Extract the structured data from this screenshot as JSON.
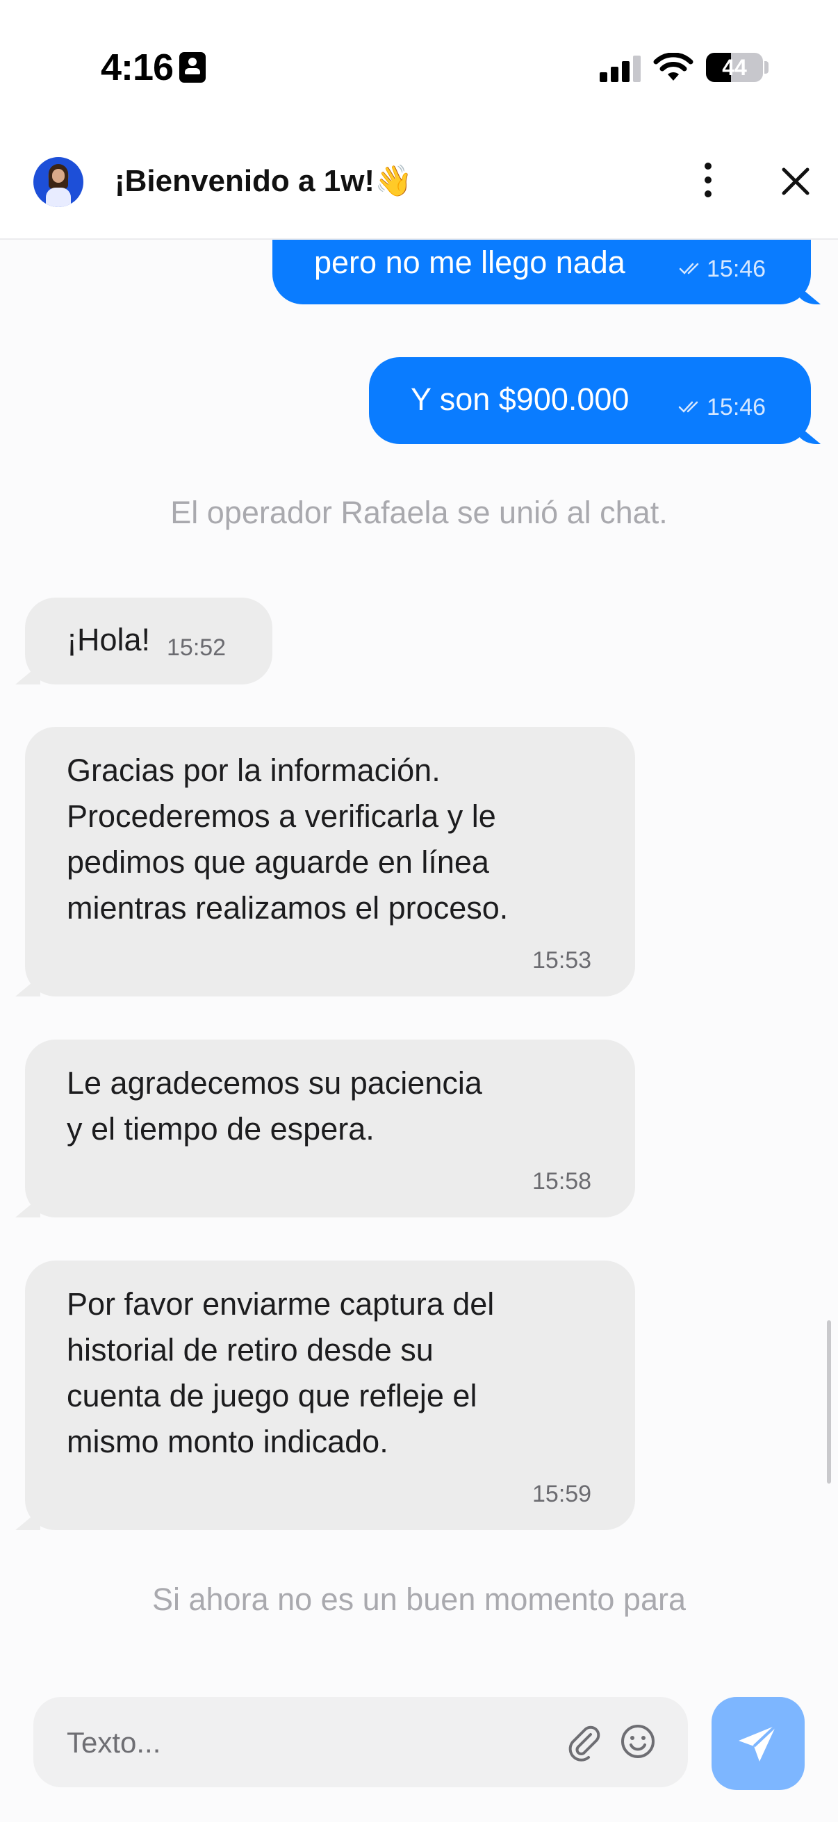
{
  "status_bar": {
    "time": "4:16",
    "battery": "44",
    "battery_level": 0.44
  },
  "header": {
    "title": "¡Bienvenido a 1w!👋",
    "avatar_icon": "agent-avatar",
    "menu_icon": "more-vertical-icon",
    "close_icon": "close-icon"
  },
  "messages": [
    {
      "direction": "outgoing",
      "text": "pero no me llego nada",
      "time": "15:46",
      "read": true
    },
    {
      "direction": "outgoing",
      "text": "Y son $900.000",
      "time": "15:46",
      "read": true
    },
    {
      "direction": "system",
      "text": "El operador Rafaela se unió al chat."
    },
    {
      "direction": "incoming",
      "text": "¡Hola!",
      "time": "15:52"
    },
    {
      "direction": "incoming",
      "text": "Gracias por la información. Procederemos a verificarla y le pedimos que aguarde en línea mientras realizamos el proceso.",
      "time": "15:53"
    },
    {
      "direction": "incoming",
      "text": "Le agradecemos su paciencia y el tiempo de espera.",
      "time": "15:58"
    },
    {
      "direction": "incoming",
      "text": "Por favor enviarme captura del historial de retiro desde su cuenta de juego que refleje el mismo monto indicado.",
      "time": "15:59"
    },
    {
      "direction": "system",
      "text": "Si ahora no es un buen momento para"
    }
  ],
  "composer": {
    "placeholder": "Texto...",
    "attach_icon": "paperclip-icon",
    "emoji_icon": "emoji-icon",
    "send_icon": "send-icon"
  },
  "colors": {
    "outgoing_bubble": "#0a7cff",
    "incoming_bubble": "#ececec",
    "send_button": "#7db6ff"
  }
}
